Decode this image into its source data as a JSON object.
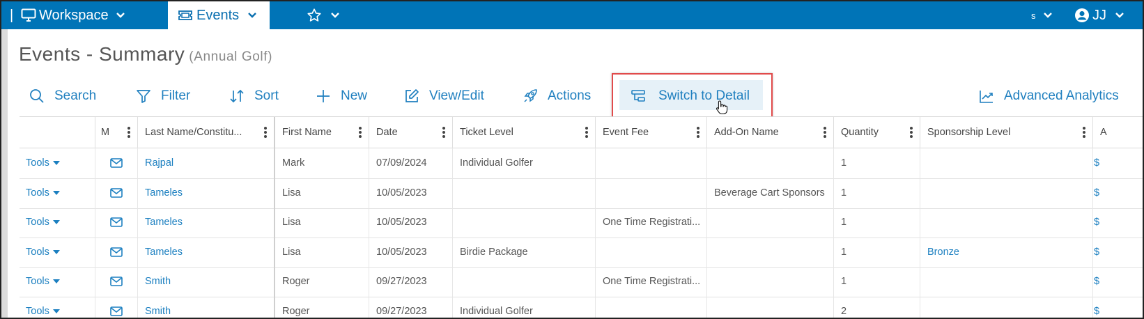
{
  "nav": {
    "workspace": "Workspace",
    "events": "Events",
    "user": "JJ",
    "partial": "s"
  },
  "page": {
    "title": "Events - Summary",
    "subtitle": "(Annual Golf)"
  },
  "toolbar": {
    "search": "Search",
    "filter": "Filter",
    "sort": "Sort",
    "new": "New",
    "view_edit": "View/Edit",
    "actions": "Actions",
    "switch_detail": "Switch to Detail",
    "advanced_analytics": "Advanced Analytics"
  },
  "grid": {
    "headers": [
      "",
      "M",
      "Last Name/Constitu...",
      "First Name",
      "Date",
      "Ticket Level",
      "Event Fee",
      "Add-On Name",
      "Quantity",
      "Sponsorship Level",
      "A"
    ],
    "rows": [
      {
        "tools": "Tools",
        "last": "Rajpal",
        "first": "Mark",
        "date": "07/09/2024",
        "ticket": "Individual Golfer",
        "fee": "",
        "addon": "",
        "qty": "1",
        "sponsor": "",
        "a": "$"
      },
      {
        "tools": "Tools",
        "last": "Tameles",
        "first": "Lisa",
        "date": "10/05/2023",
        "ticket": "",
        "fee": "",
        "addon": "Beverage Cart Sponsors",
        "qty": "1",
        "sponsor": "",
        "a": "$"
      },
      {
        "tools": "Tools",
        "last": "Tameles",
        "first": "Lisa",
        "date": "10/05/2023",
        "ticket": "",
        "fee": "One Time Registrati...",
        "addon": "",
        "qty": "1",
        "sponsor": "",
        "a": "$"
      },
      {
        "tools": "Tools",
        "last": "Tameles",
        "first": "Lisa",
        "date": "10/05/2023",
        "ticket": "Birdie Package",
        "fee": "",
        "addon": "",
        "qty": "1",
        "sponsor": "Bronze",
        "a": "$"
      },
      {
        "tools": "Tools",
        "last": "Smith",
        "first": "Roger",
        "date": "09/27/2023",
        "ticket": "",
        "fee": "One Time Registrati...",
        "addon": "",
        "qty": "1",
        "sponsor": "",
        "a": "$"
      },
      {
        "tools": "Tools",
        "last": "Smith",
        "first": "Roger",
        "date": "09/27/2023",
        "ticket": "Individual Golfer",
        "fee": "",
        "addon": "",
        "qty": "2",
        "sponsor": "",
        "a": "$"
      }
    ]
  },
  "colors": {
    "nav_bg": "#0074b7",
    "link": "#1b7fc0",
    "highlight": "#e14b4b"
  }
}
